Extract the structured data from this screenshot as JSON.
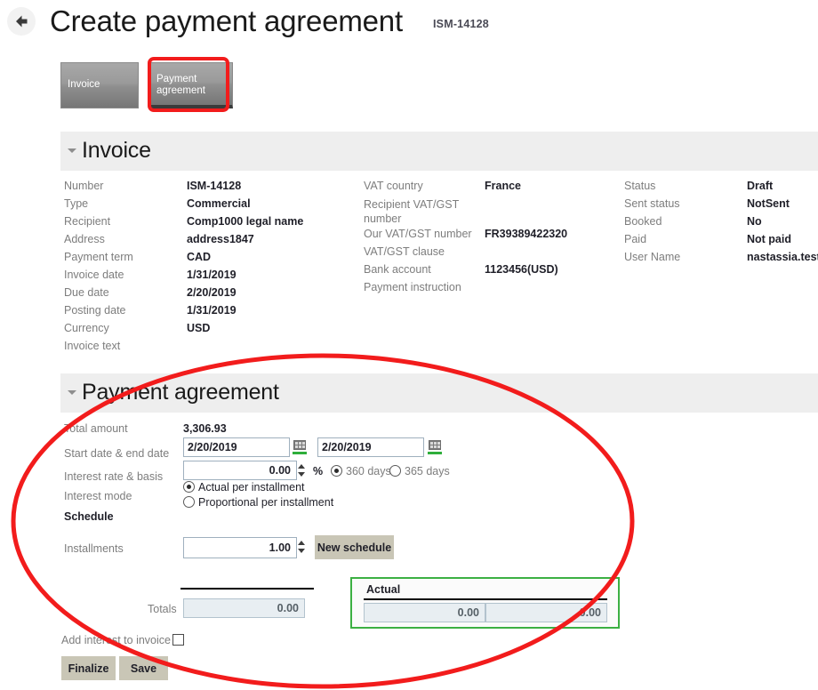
{
  "header": {
    "back_icon": "back-arrow-icon",
    "title": "Create payment agreement",
    "subtitle": "ISM-14128"
  },
  "tabs": [
    {
      "id": "invoice",
      "label": "Invoice",
      "active": false
    },
    {
      "id": "payment-agreement",
      "label_line1": "Payment",
      "label_line2": "agreement",
      "active": true
    }
  ],
  "invoice_section": {
    "title": "Invoice",
    "col1": [
      {
        "label": "Number",
        "value": "ISM-14128"
      },
      {
        "label": "Type",
        "value": "Commercial"
      },
      {
        "label": "Recipient",
        "value": "Comp1000 legal name"
      },
      {
        "label": "Address",
        "value": "address1847"
      },
      {
        "label": "Payment term",
        "value": "CAD"
      },
      {
        "label": "Invoice date",
        "value": "1/31/2019"
      },
      {
        "label": "Due date",
        "value": "2/20/2019"
      },
      {
        "label": "Posting date",
        "value": "1/31/2019"
      },
      {
        "label": "Currency",
        "value": "USD"
      },
      {
        "label": "Invoice text",
        "value": ""
      }
    ],
    "col2": [
      {
        "label": "VAT country",
        "value": "France"
      },
      {
        "label": "Recipient VAT/GST number",
        "value": ""
      },
      {
        "label": "Our VAT/GST number",
        "value": "FR39389422320"
      },
      {
        "label": "VAT/GST clause",
        "value": ""
      },
      {
        "label": "Bank account",
        "value": "1123456(USD)"
      },
      {
        "label": "Payment instruction",
        "value": ""
      }
    ],
    "col3": [
      {
        "label": "Status",
        "value": "Draft"
      },
      {
        "label": "Sent status",
        "value": "NotSent"
      },
      {
        "label": "Booked",
        "value": "No"
      },
      {
        "label": "Paid",
        "value": "Not paid"
      },
      {
        "label": "User Name",
        "value": "nastassia.test"
      }
    ]
  },
  "payment_agreement": {
    "title": "Payment agreement",
    "total_amount_label": "Total amount",
    "total_amount_value": "3,306.93",
    "dates_label": "Start date & end date",
    "start_date": "2/20/2019",
    "end_date": "2/20/2019",
    "calendar_icon": "calendar-icon",
    "interest_label": "Interest rate & basis",
    "interest_rate": "0.00",
    "percent_sign": "%",
    "basis_options": [
      {
        "label": "360 days",
        "selected": true
      },
      {
        "label": "365 days",
        "selected": false
      }
    ],
    "interest_mode_label": "Interest mode",
    "interest_mode_options": [
      {
        "label": "Actual per installment",
        "selected": true
      },
      {
        "label": "Proportional per installment",
        "selected": false
      }
    ],
    "schedule_label": "Schedule",
    "installments_label": "Installments",
    "installments_value": "1.00",
    "new_schedule_label": "New schedule",
    "totals_label": "Totals",
    "totals_value": "0.00",
    "actual_group_label": "Actual",
    "actual_value_1": "0.00",
    "actual_value_2": "0.00",
    "add_interest_label": "Add interest to invoice",
    "add_interest_checked": false,
    "finalize_label": "Finalize",
    "save_label": "Save"
  },
  "annotations": {
    "tab_highlight_color": "#f21c1c",
    "section_highlight_color": "#f21c1c",
    "actual_group_color": "#3cb043"
  }
}
